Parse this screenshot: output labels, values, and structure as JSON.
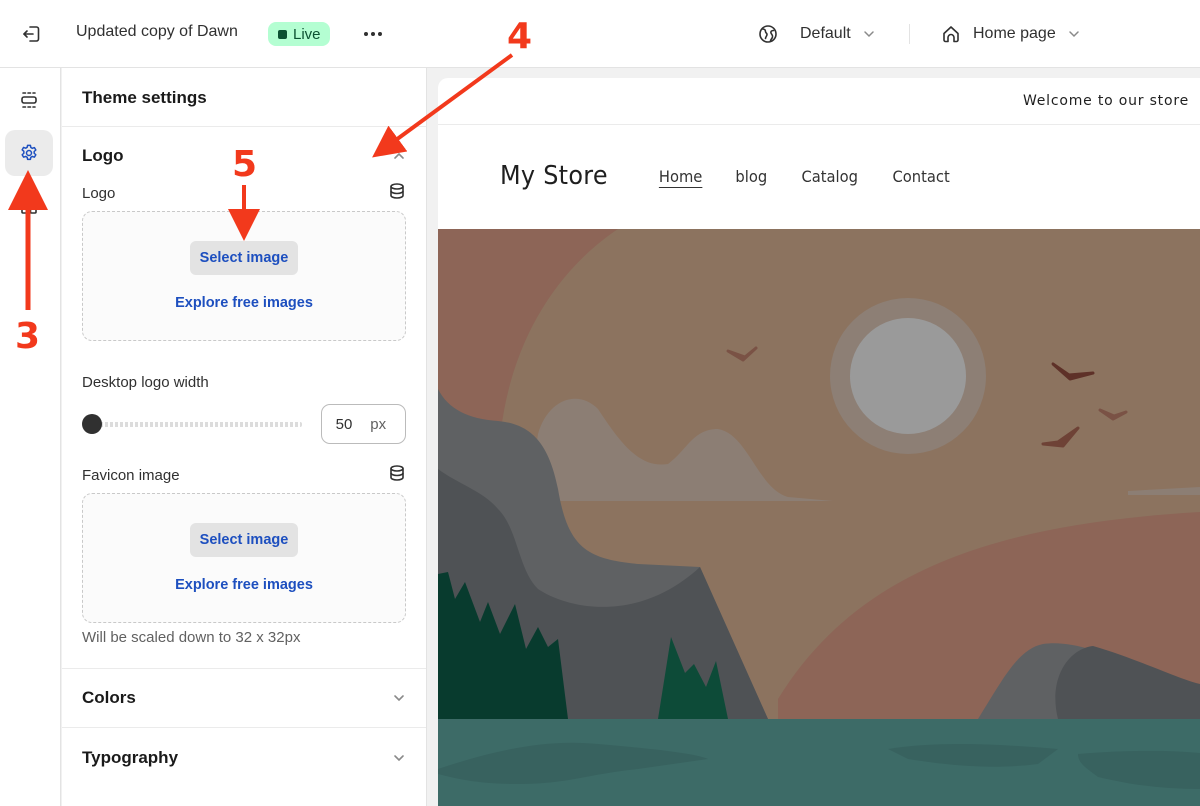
{
  "topbar": {
    "exit_icon": "exit-icon",
    "theme_name": "Updated copy of Dawn",
    "status_badge": "Live",
    "more_icon": "more-horizontal-icon",
    "more_label": "•••",
    "market_selector": {
      "icon": "globe-icon",
      "label": "Default"
    },
    "page_selector": {
      "icon": "home-icon",
      "label": "Home page"
    }
  },
  "icon_rail": [
    {
      "name": "sections-icon",
      "active": false
    },
    {
      "name": "theme-settings-icon",
      "active": true
    },
    {
      "name": "app-embeds-icon",
      "active": false
    }
  ],
  "panel": {
    "title": "Theme settings",
    "logo_section": {
      "title": "Logo",
      "expanded": true,
      "logo_field": {
        "label": "Logo",
        "select_button": "Select image",
        "explore_link": "Explore free images"
      },
      "desktop_logo_width": {
        "label": "Desktop logo width",
        "value": "50",
        "unit": "px",
        "slider_fraction": 0.0
      },
      "favicon_field": {
        "label": "Favicon image",
        "select_button": "Select image",
        "explore_link": "Explore free images",
        "help_text": "Will be scaled down to 32 x 32px"
      }
    },
    "collapsed_sections": [
      {
        "title": "Colors"
      },
      {
        "title": "Typography"
      }
    ]
  },
  "preview": {
    "announcement": "Welcome to our store",
    "store_name": "My Store",
    "nav": [
      {
        "label": "Home",
        "current": true
      },
      {
        "label": "blog",
        "current": false
      },
      {
        "label": "Catalog",
        "current": false
      },
      {
        "label": "Contact",
        "current": false
      }
    ]
  },
  "annotations": [
    {
      "number": "3",
      "target": "theme-settings-icon"
    },
    {
      "number": "4",
      "target": "logo-section-toggle"
    },
    {
      "number": "5",
      "target": "logo-select-image-button"
    }
  ],
  "colors": {
    "live_badge_bg": "#b4fed2",
    "live_badge_text": "#0c5132",
    "link_blue": "#1d4fbf",
    "annotation_red": "#f2391c",
    "active_icon_blue": "#1d4fbf"
  }
}
